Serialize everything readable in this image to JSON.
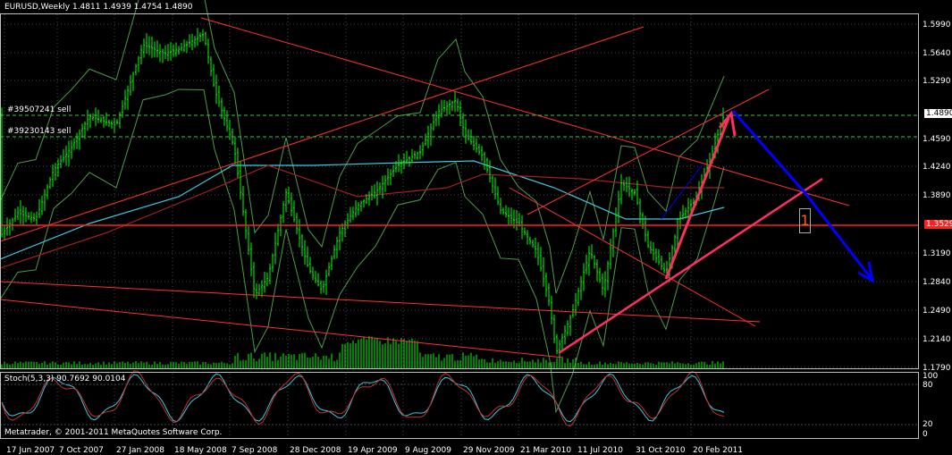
{
  "header": {
    "title": "EURUSD,Weekly  1.4811 1.4939 1.4754 1.4890"
  },
  "stoch": {
    "label": "Stoch(5,3,3) 90.7692 90.0104",
    "scale": [
      "100",
      "80",
      "20",
      "0"
    ]
  },
  "footer": {
    "copyright": "Metatrader, © 2001-2011 MetaQuotes Software Corp."
  },
  "orders": [
    {
      "label": "#39507241 sell"
    },
    {
      "label": "#39230143 sell"
    }
  ],
  "price_axis": {
    "ticks": [
      "1.5990",
      "1.5640",
      "1.5290",
      "1.4590",
      "1.4240",
      "1.3890",
      "1.3190",
      "1.2840",
      "1.2490",
      "1.2140",
      "1.1790"
    ],
    "current_price": "1.4890",
    "marker_price": "1.3529",
    "marker_digit": "1"
  },
  "time_axis": {
    "labels": [
      "17 Jun 2007",
      "7 Oct 2007",
      "27 Jan 2008",
      "18 May 2008",
      "7 Sep 2008",
      "28 Dec 2008",
      "19 Apr 2009",
      "9 Aug 2009",
      "29 Nov 2009",
      "21 Mar 2010",
      "11 Jul 2010",
      "31 Oct 2010",
      "20 Feb 2011"
    ]
  },
  "colors": {
    "background": "#000000",
    "grid": "#3f4a55",
    "candle": "#00ff00",
    "trendline": "#ff3030",
    "arrow_red": "#ff2e63",
    "arrow_blue": "#0000ff",
    "ma_red": "#a02020",
    "ma_cyan": "#40c8e0",
    "bands": "#4f9a4f",
    "price_box": "#ffffff",
    "marker_box": "#ff2020"
  }
}
